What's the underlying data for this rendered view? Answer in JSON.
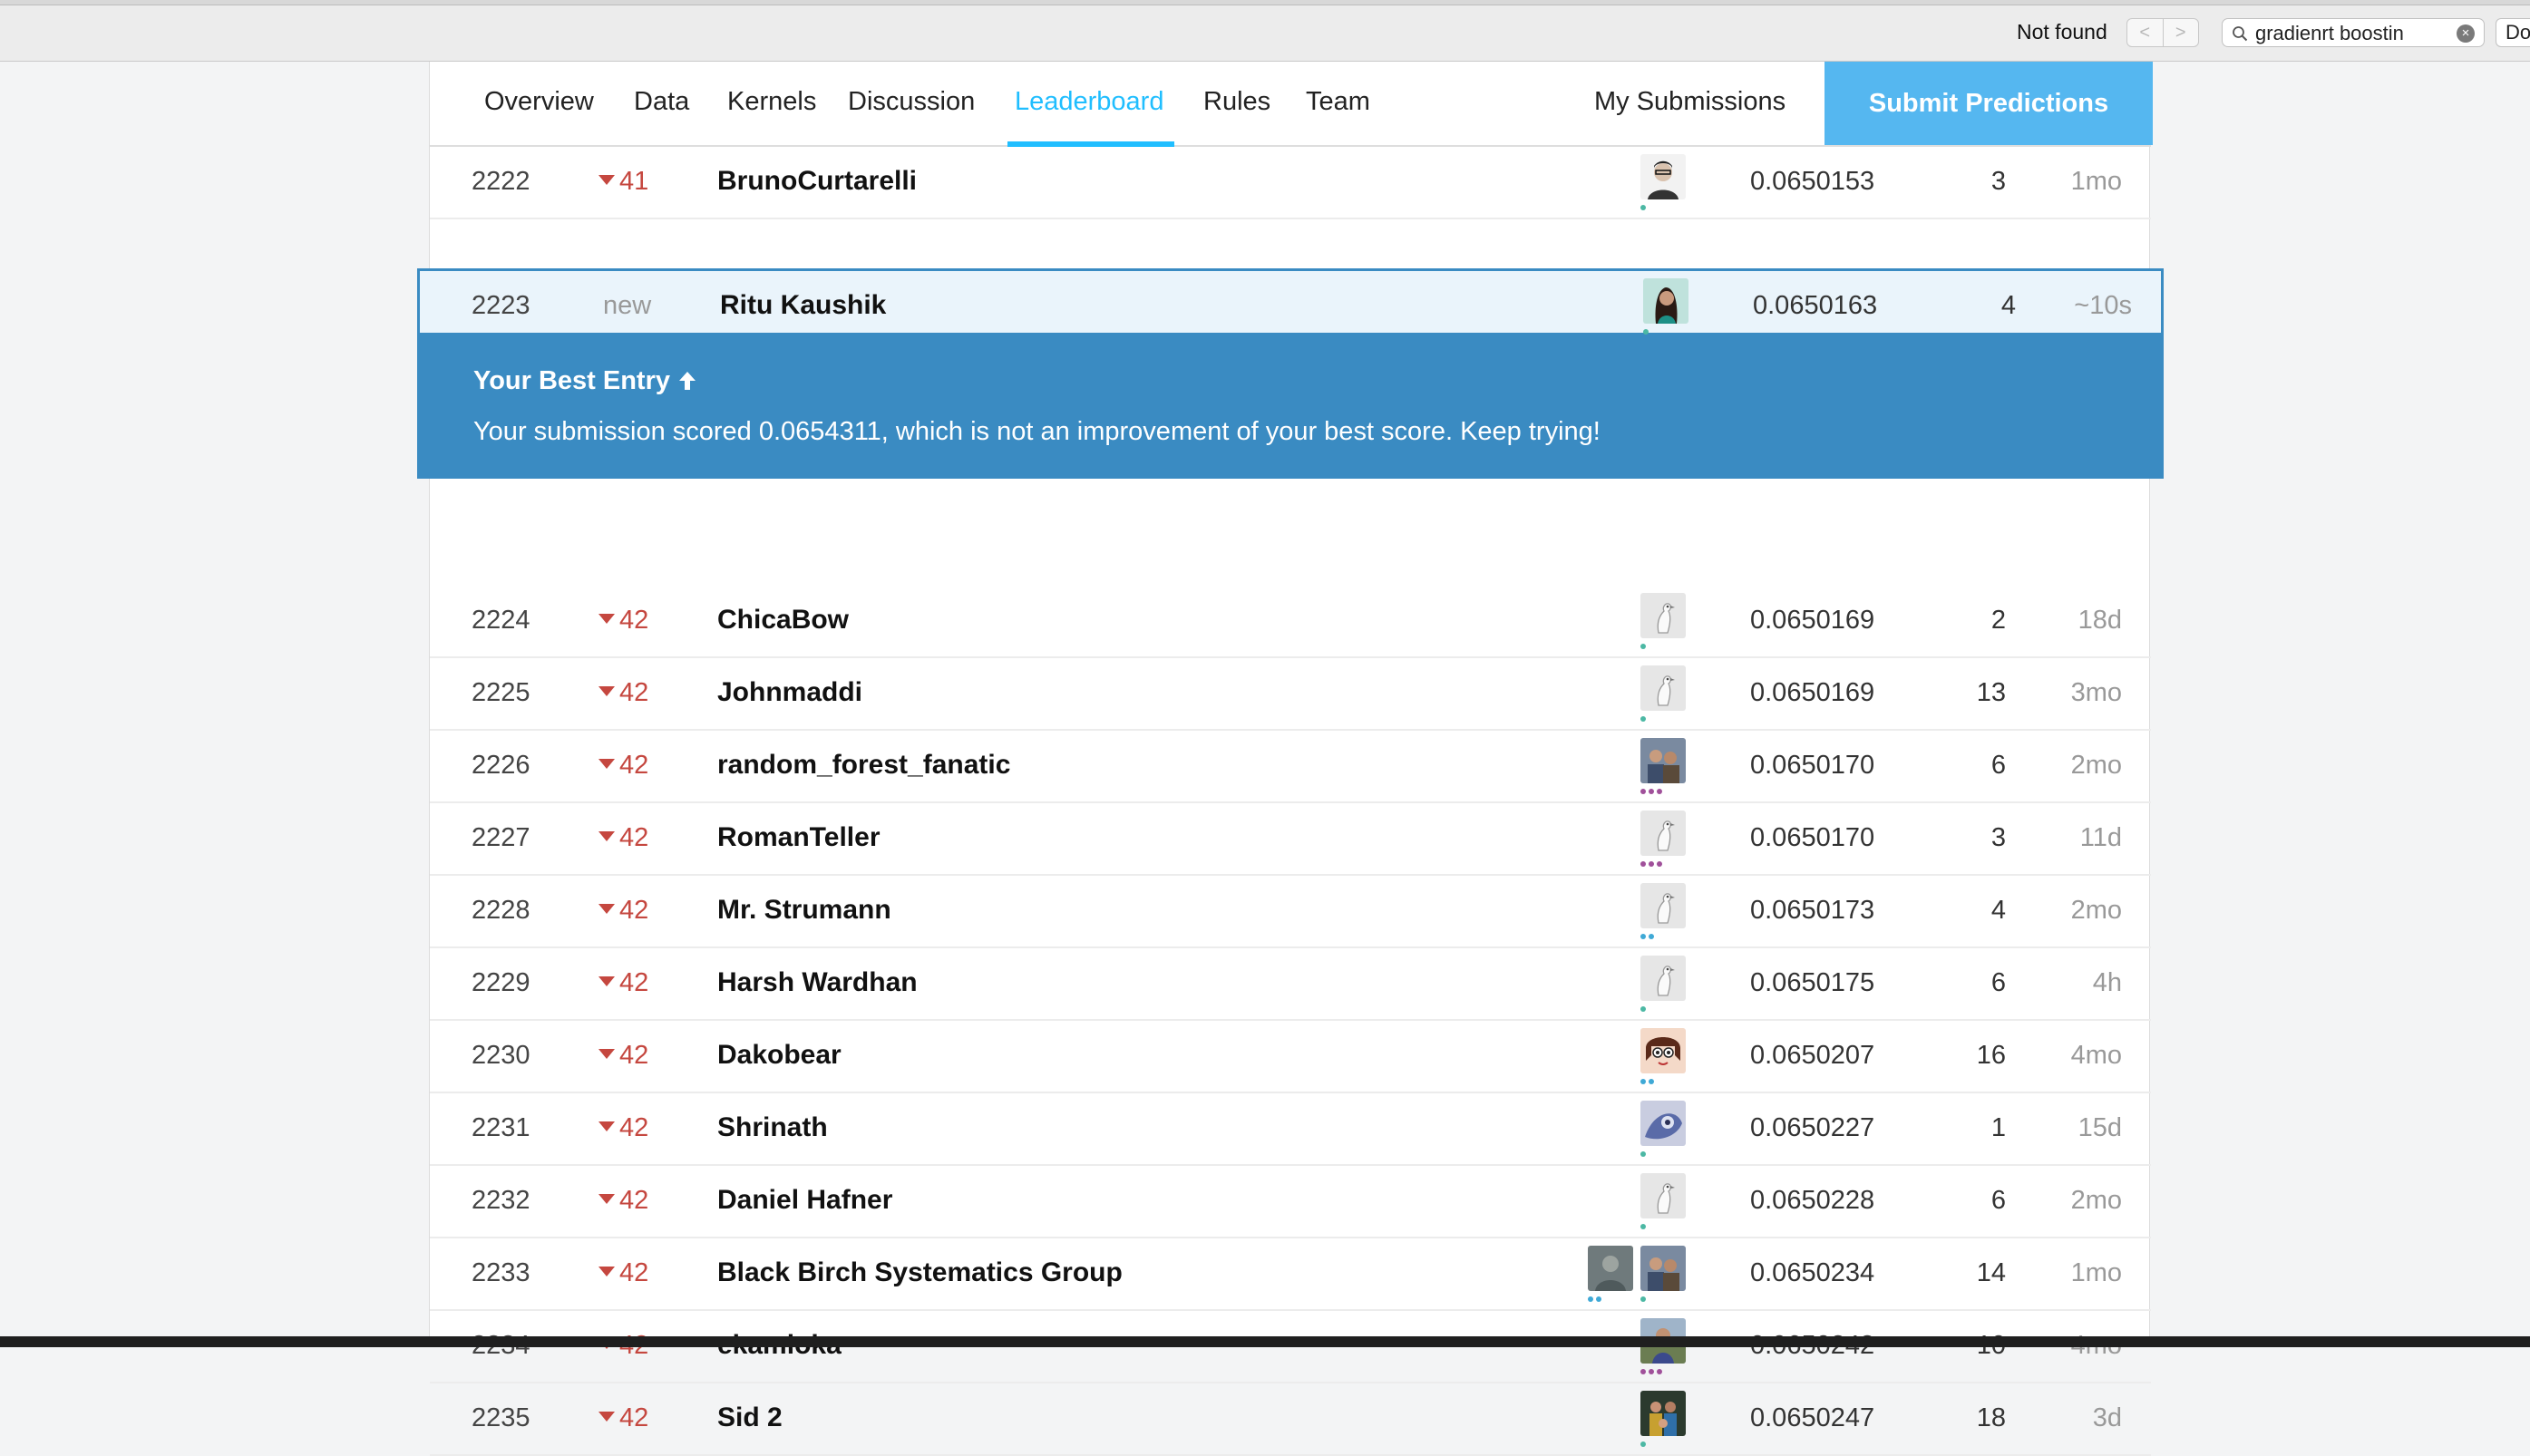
{
  "findbar": {
    "status": "Not found",
    "prev": "<",
    "next": ">",
    "query": "gradienrt boostin",
    "done_label": "Do"
  },
  "nav": {
    "tabs": [
      "Overview",
      "Data",
      "Kernels",
      "Discussion",
      "Leaderboard",
      "Rules",
      "Team"
    ],
    "active": "Leaderboard",
    "my_submissions": "My Submissions",
    "submit": "Submit Predictions"
  },
  "best_entry": {
    "title": "Your Best Entry",
    "message": "Your submission scored 0.0654311, which is not an improvement of your best score. Keep trying!"
  },
  "colors": {
    "accent": "#20beff",
    "panel": "#3a8bc2",
    "down": "#c5473f"
  },
  "rows": [
    {
      "rank": "2222",
      "delta": "41",
      "name": "BrunoCurtarelli",
      "avatar": "portrait-bw",
      "dots": [
        "#4cb8a4"
      ],
      "score": "0.0650153",
      "entries": "3",
      "last": "1mo"
    },
    {
      "rank": "2223",
      "delta": "new",
      "name": "Ritu Kaushik",
      "avatar": "portrait-teal",
      "dots": [
        "#4cb8a4"
      ],
      "score": "0.0650163",
      "entries": "4",
      "last": "~10s",
      "mine": true
    },
    {
      "rank": "2224",
      "delta": "42",
      "name": "ChicaBow",
      "avatar": "default-goose",
      "dots": [
        "#4cb8a4"
      ],
      "score": "0.0650169",
      "entries": "2",
      "last": "18d"
    },
    {
      "rank": "2225",
      "delta": "42",
      "name": "Johnmaddi",
      "avatar": "default-goose",
      "dots": [
        "#4cb8a4"
      ],
      "score": "0.0650169",
      "entries": "13",
      "last": "3mo"
    },
    {
      "rank": "2226",
      "delta": "42",
      "name": "random_forest_fanatic",
      "avatar": "photo-people",
      "dots": [
        "#a0509a",
        "#a0509a",
        "#a0509a"
      ],
      "score": "0.0650170",
      "entries": "6",
      "last": "2mo"
    },
    {
      "rank": "2227",
      "delta": "42",
      "name": "RomanTeller",
      "avatar": "default-goose",
      "dots": [
        "#a0509a",
        "#a0509a",
        "#a0509a"
      ],
      "score": "0.0650170",
      "entries": "3",
      "last": "11d"
    },
    {
      "rank": "2228",
      "delta": "42",
      "name": "Mr. Strumann",
      "avatar": "default-goose",
      "dots": [
        "#3fa9d6",
        "#3fa9d6"
      ],
      "score": "0.0650173",
      "entries": "4",
      "last": "2mo"
    },
    {
      "rank": "2229",
      "delta": "42",
      "name": "Harsh Wardhan",
      "avatar": "default-goose",
      "dots": [
        "#4cb8a4"
      ],
      "score": "0.0650175",
      "entries": "6",
      "last": "4h"
    },
    {
      "rank": "2230",
      "delta": "42",
      "name": "Dakobear",
      "avatar": "cartoon-face",
      "dots": [
        "#3fa9d6",
        "#3fa9d6"
      ],
      "score": "0.0650207",
      "entries": "16",
      "last": "4mo"
    },
    {
      "rank": "2231",
      "delta": "42",
      "name": "Shrinath",
      "avatar": "abstract-blue",
      "dots": [
        "#4cb8a4"
      ],
      "score": "0.0650227",
      "entries": "1",
      "last": "15d"
    },
    {
      "rank": "2232",
      "delta": "42",
      "name": "Daniel Hafner",
      "avatar": "default-goose",
      "dots": [
        "#4cb8a4"
      ],
      "score": "0.0650228",
      "entries": "6",
      "last": "2mo"
    },
    {
      "rank": "2233",
      "delta": "42",
      "name": "Black Birch Systematics Group",
      "avatar": "team-two",
      "dots": [
        "#3fa9d6",
        "#3fa9d6"
      ],
      "score": "0.0650234",
      "entries": "14",
      "last": "1mo"
    },
    {
      "rank": "2234",
      "delta": "42",
      "name": "ekamioka",
      "avatar": "photo-man",
      "dots": [
        "#a0509a",
        "#a0509a",
        "#a0509a"
      ],
      "score": "0.0650242",
      "entries": "10",
      "last": "4mo"
    },
    {
      "rank": "2235",
      "delta": "42",
      "name": "Sid 2",
      "avatar": "photo-family",
      "dots": [
        "#4cb8a4"
      ],
      "score": "0.0650247",
      "entries": "18",
      "last": "3d"
    }
  ]
}
